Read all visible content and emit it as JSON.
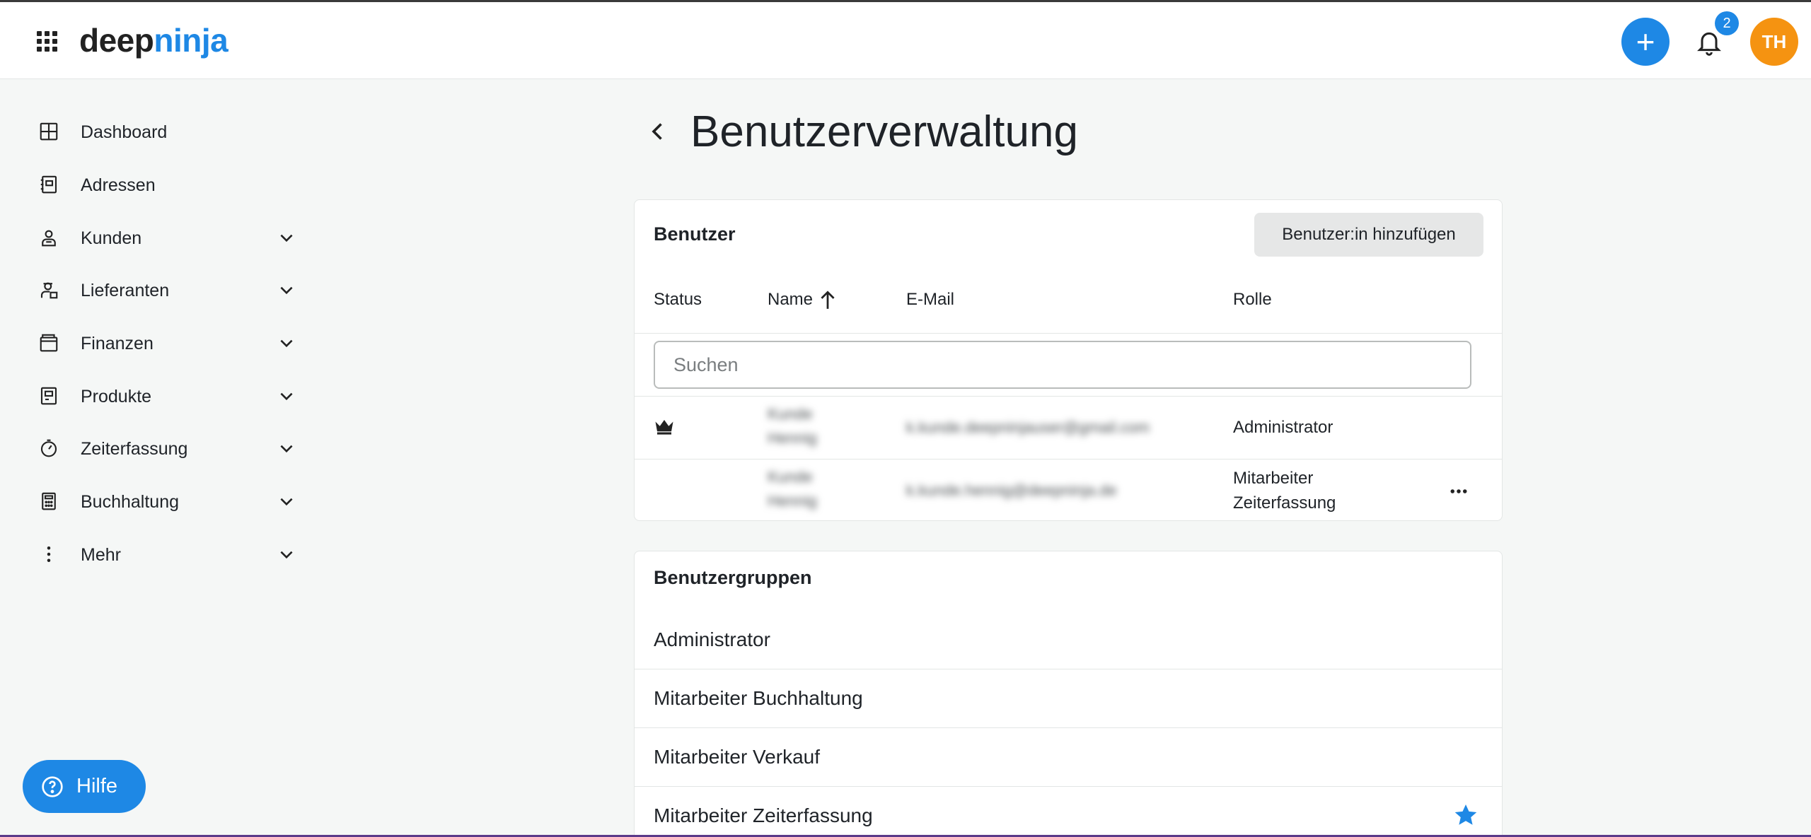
{
  "header": {
    "logo_part1": "deep",
    "logo_part2": "ninja",
    "notification_count": "2",
    "avatar_initials": "TH"
  },
  "sidebar": {
    "items": [
      {
        "label": "Dashboard",
        "icon": "dashboard-icon"
      },
      {
        "label": "Adressen",
        "icon": "address-book-icon"
      },
      {
        "label": "Kunden",
        "icon": "customer-icon"
      },
      {
        "label": "Lieferanten",
        "icon": "supplier-icon"
      },
      {
        "label": "Finanzen",
        "icon": "wallet-icon"
      },
      {
        "label": "Produkte",
        "icon": "product-icon"
      },
      {
        "label": "Zeiterfassung",
        "icon": "stopwatch-icon"
      },
      {
        "label": "Buchhaltung",
        "icon": "calculator-icon"
      },
      {
        "label": "Mehr",
        "icon": "more-vertical-icon"
      }
    ],
    "help_label": "Hilfe"
  },
  "page": {
    "title": "Benutzerverwaltung"
  },
  "users_card": {
    "title": "Benutzer",
    "add_button": "Benutzer:in hinzufügen",
    "columns": {
      "status": "Status",
      "name": "Name",
      "email": "E-Mail",
      "role": "Rolle"
    },
    "search_placeholder": "Suchen",
    "rows": [
      {
        "name_line1": "Kunde",
        "name_line2": "Hennig",
        "email": "k.kunde.deepninjauser@gmail.com",
        "role_line1": "Administrator",
        "role_line2": "",
        "status_icon": "crown-icon"
      },
      {
        "name_line1": "Kunde",
        "name_line2": "Hennig",
        "email": "k.kunde.hennig@deepninja.de",
        "role_line1": "Mitarbeiter",
        "role_line2": "Zeiterfassung",
        "status_icon": ""
      }
    ]
  },
  "groups_card": {
    "title": "Benutzergruppen",
    "groups": [
      {
        "label": "Administrator"
      },
      {
        "label": "Mitarbeiter Buchhaltung"
      },
      {
        "label": "Mitarbeiter Verkauf"
      },
      {
        "label": "Mitarbeiter Zeiterfassung",
        "starred": true
      }
    ]
  },
  "colors": {
    "accent": "#1e88e5",
    "avatar": "#f59311",
    "background": "#f5f7f6"
  }
}
